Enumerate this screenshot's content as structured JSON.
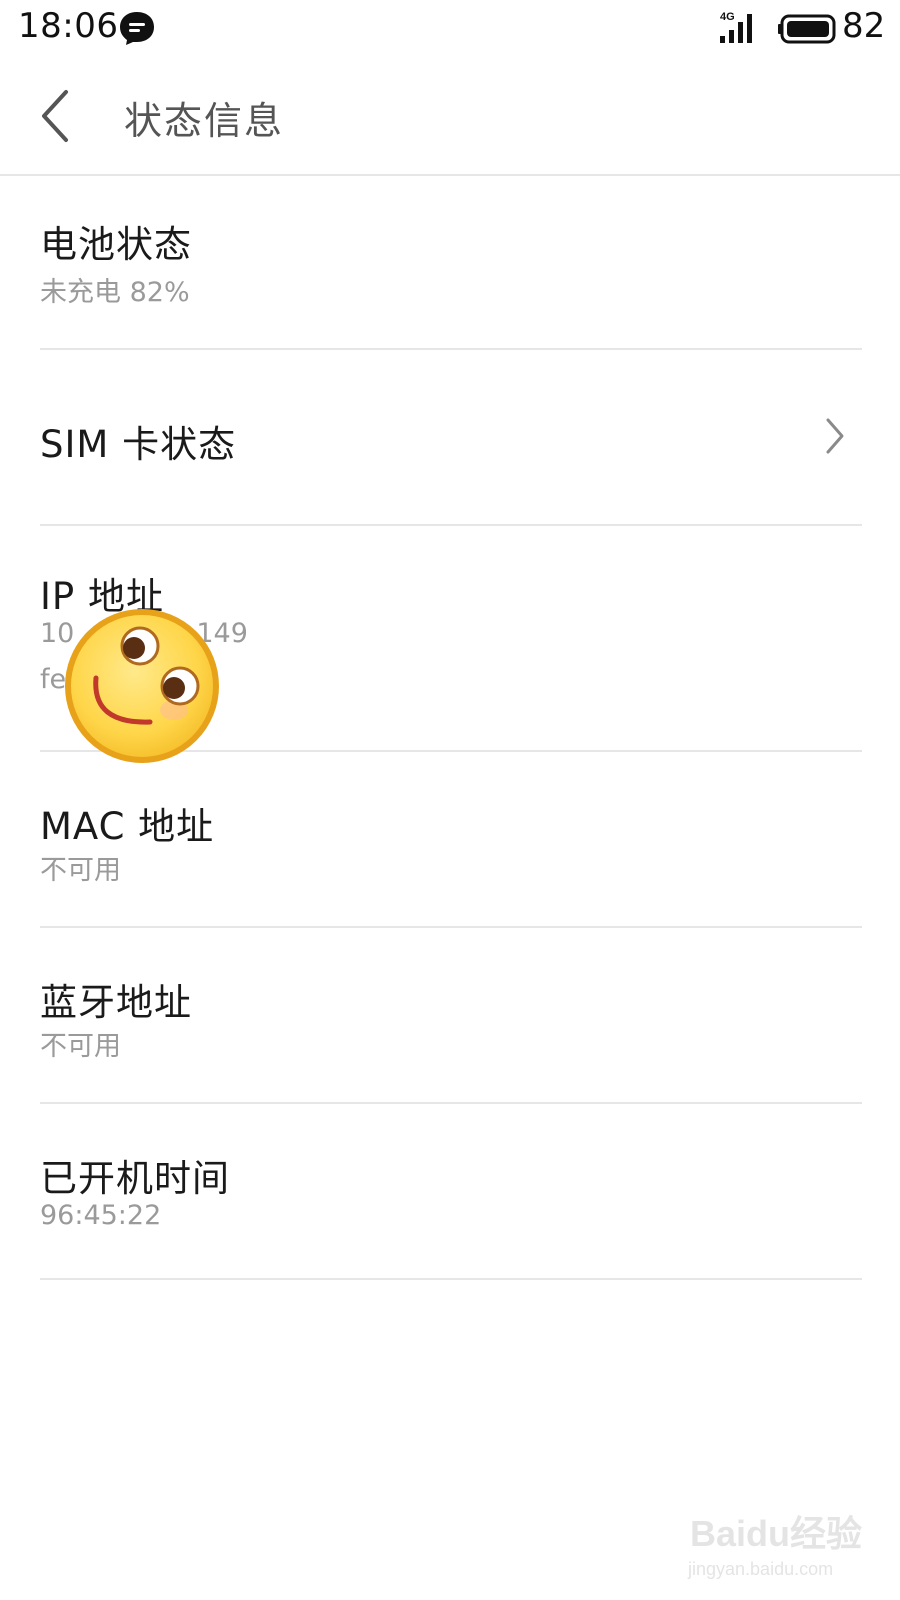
{
  "status_bar": {
    "time": "18:06",
    "message_icon": "chat-bubble-icon",
    "network_type": "4G",
    "signal_icon": "signal-bars-icon",
    "battery_icon": "battery-icon",
    "battery_level": "82"
  },
  "header": {
    "back_icon": "chevron-left-icon",
    "title": "状态信息"
  },
  "list": [
    {
      "title": "电池状态",
      "subtitle": "未充电 82%"
    },
    {
      "title": "SIM 卡状态",
      "chevron": "chevron-right-icon"
    },
    {
      "title": "IP 地址",
      "subtitle_line1": "10",
      "subtitle_line1_tail": "149",
      "subtitle_line2": "fe"
    },
    {
      "title": "MAC 地址",
      "subtitle": "不可用"
    },
    {
      "title": "蓝牙地址",
      "subtitle": "不可用"
    },
    {
      "title": "已开机时间",
      "subtitle": "96:45:22"
    }
  ],
  "overlay": {
    "sticker_icon": "smiley-face-sticker-icon"
  },
  "watermark": {
    "line1": "Baidu经验",
    "line2": "jingyan.baidu.com"
  }
}
